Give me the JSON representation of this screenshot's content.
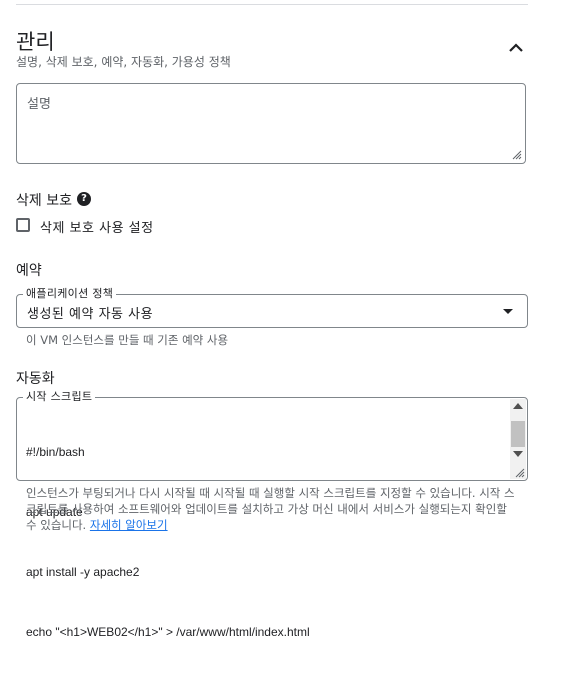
{
  "management": {
    "title": "관리",
    "subtitle": "설명, 삭제 보호, 예약, 자동화, 가용성 정책",
    "collapse_icon": "chevron-up-icon"
  },
  "description": {
    "placeholder": "설명"
  },
  "deletion_protection": {
    "heading": "삭제 보호",
    "help_icon": "help-icon",
    "checkbox_label": "삭제 보호 사용 설정",
    "checked": false
  },
  "reservation": {
    "heading": "예약",
    "field_label": "애플리케이션 정책",
    "selected_value": "생성된 예약 자동 사용",
    "hint": "이 VM 인스턴스를 만들 때 기존 예약 사용"
  },
  "automation": {
    "heading": "자동화",
    "field_label": "시작 스크립트",
    "script_lines": [
      "#!/bin/bash",
      "apt update",
      "apt install -y apache2",
      "echo \"<h1>WEB02</h1>\" > /var/www/html/index.html"
    ],
    "description": "인스턴스가 부팅되거나 다시 시작될 때 시작될 때 실행할 시작 스크립트를 지정할 수 있습니다. 시작 스크립트를 사용하여 소프트웨어와 업데이트를 설치하고 가상 머신 내에서 서비스가 실행되는지 확인할 수 있습니다.",
    "learn_more": "자세히 알아보기"
  }
}
